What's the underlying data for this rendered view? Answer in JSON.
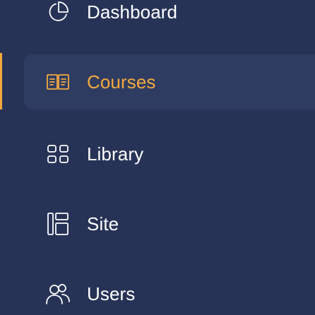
{
  "colors": {
    "background": "#273356",
    "active_background": "#2f3c61",
    "accent": "#f3aa3f",
    "text": "#ffffff"
  },
  "sidebar": {
    "items": [
      {
        "label": "Dashboard",
        "icon": "pie-chart-icon",
        "active": false
      },
      {
        "label": "Courses",
        "icon": "open-book-icon",
        "active": true
      },
      {
        "label": "Library",
        "icon": "grid-icon",
        "active": false
      },
      {
        "label": "Site",
        "icon": "layout-icon",
        "active": false
      },
      {
        "label": "Users",
        "icon": "users-icon",
        "active": false
      }
    ]
  }
}
